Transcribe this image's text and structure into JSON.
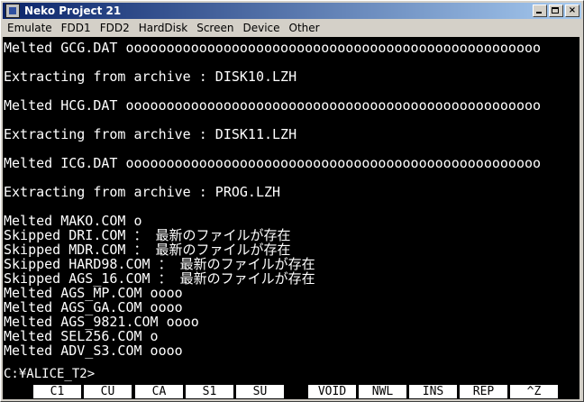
{
  "window": {
    "title": "Neko Project 21"
  },
  "menu": [
    "Emulate",
    "FDD1",
    "FDD2",
    "HardDisk",
    "Screen",
    "Device",
    "Other"
  ],
  "terminal": {
    "lines": [
      {
        "text": "Melted   GCG.DAT         ooooooooooooooooooooooooooooooooooooooooooooooooooo",
        "row": 0
      },
      {
        "text": "Extracting from archive : DISK10.LZH",
        "row": 2
      },
      {
        "text": "Melted   HCG.DAT         ooooooooooooooooooooooooooooooooooooooooooooooooooo",
        "row": 4
      },
      {
        "text": "Extracting from archive : DISK11.LZH",
        "row": 6
      },
      {
        "text": "Melted   ICG.DAT         ooooooooooooooooooooooooooooooooooooooooooooooooooo",
        "row": 8
      },
      {
        "text": "Extracting from archive : PROG.LZH",
        "row": 10
      },
      {
        "text": "Melted   MAKO.COM      o",
        "row": 12
      },
      {
        "text": "Skipped  DRI.COM       ： 最新のファイルが存在",
        "row": 13
      },
      {
        "text": "Skipped  MDR.COM       ： 最新のファイルが存在",
        "row": 14
      },
      {
        "text": "Skipped  HARD98.COM    ： 最新のファイルが存在",
        "row": 15
      },
      {
        "text": "Skipped  AGS_16.COM    ： 最新のファイルが存在",
        "row": 16
      },
      {
        "text": "Melted   AGS_MP.COM    oooo",
        "row": 17
      },
      {
        "text": "Melted   AGS_GA.COM    oooo",
        "row": 18
      },
      {
        "text": "Melted   AGS_9821.COM oooo",
        "row": 19
      },
      {
        "text": "Melted   SEL256.COM    o",
        "row": 20
      },
      {
        "text": "Melted   ADV_S3.COM    oooo",
        "row": 21
      }
    ],
    "prompt": "C:¥ALICE_T2>"
  },
  "fkeys": [
    "C1",
    "CU",
    "CA",
    "S1",
    "SU",
    "VOID",
    "NWL",
    "INS",
    "REP",
    "^Z"
  ]
}
